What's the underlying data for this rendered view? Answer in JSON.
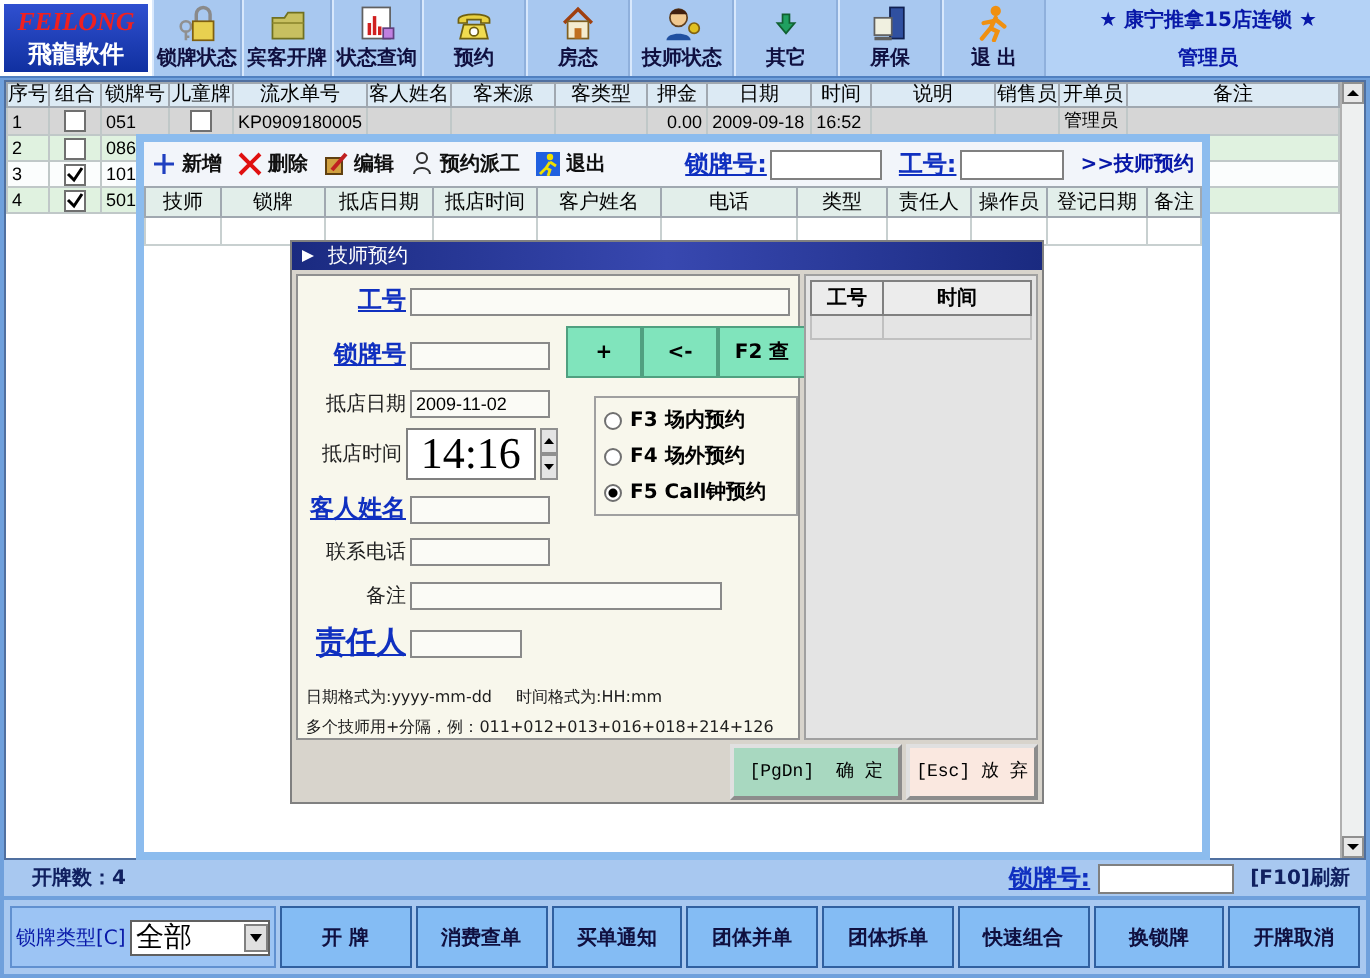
{
  "header": {
    "logo_top": "FEILONG",
    "logo_bottom": "飛龍軟件",
    "store": "★ 康宁推拿15店连锁 ★",
    "user": "管理员"
  },
  "toolbar": [
    {
      "label": "锁牌状态",
      "kind": "lock"
    },
    {
      "label": "宾客开牌",
      "kind": "folder"
    },
    {
      "label": "状态查询",
      "kind": "chart"
    },
    {
      "label": "预约",
      "kind": "phone"
    },
    {
      "label": "房态",
      "kind": "house"
    },
    {
      "label": "技师状态",
      "kind": "person"
    },
    {
      "label": "其它",
      "kind": "arrow"
    },
    {
      "label": "屏保",
      "kind": "computer"
    },
    {
      "label": "退 出",
      "kind": "runner"
    }
  ],
  "main_table": {
    "columns": [
      "序号",
      "组合",
      "锁牌号",
      "儿童牌",
      "流水单号",
      "客人姓名",
      "客来源",
      "客类型",
      "押金",
      "日期",
      "时间",
      "说明",
      "销售员",
      "开单员",
      "备注"
    ],
    "rows": [
      {
        "no": "1",
        "selected": true,
        "combined": false,
        "lock_no": "051",
        "child": false,
        "serial": "KP0909180005",
        "deposit": "0.00",
        "date": "2009-09-18",
        "time": "16:52",
        "opener": "管理员"
      },
      {
        "no": "2",
        "selected": false,
        "combined": false,
        "lock_no": "086"
      },
      {
        "no": "3",
        "selected": false,
        "combined": true,
        "lock_no": "101"
      },
      {
        "no": "4",
        "selected": false,
        "combined": true,
        "lock_no": "501"
      }
    ]
  },
  "status_bar": {
    "count": "开牌数：4",
    "lock_link": "锁牌号:",
    "refresh": "[F10]刷新"
  },
  "bottom_bar": {
    "type_label": "锁牌类型[C]",
    "type_value": "全部",
    "buttons": [
      "开 牌",
      "消费查单",
      "买单通知",
      "团体并单",
      "团体拆单",
      "快速组合",
      "换锁牌",
      "开牌取消"
    ]
  },
  "booking_list": {
    "actions": [
      {
        "label": "新增",
        "kind": "add"
      },
      {
        "label": "删除",
        "kind": "delete"
      },
      {
        "label": "编辑",
        "kind": "edit"
      },
      {
        "label": "预约派工",
        "kind": "dispatch"
      },
      {
        "label": "退出",
        "kind": "exit"
      }
    ],
    "lock_label": "锁牌号:",
    "staff_label": "工号:",
    "link": ">>技师预约",
    "columns": [
      "技师",
      "锁牌",
      "抵店日期",
      "抵店时间",
      "客户姓名",
      "电话",
      "类型",
      "责任人",
      "操作员",
      "登记日期",
      "备注"
    ]
  },
  "booking_dialog": {
    "title": "技师预约",
    "staff_no_label": "工号",
    "lock_no_label": "锁牌号",
    "keypad": [
      "+",
      "<-",
      "F2 查"
    ],
    "date_label": "抵店日期",
    "date_value": "2009-11-02",
    "time_label": "抵店时间",
    "time_value": "14:16",
    "modes": [
      {
        "label": "F3 场内预约",
        "selected": false
      },
      {
        "label": "F4 场外预约",
        "selected": false
      },
      {
        "label": "F5 Call钟预约",
        "selected": true
      }
    ],
    "guest_label": "客人姓名",
    "phone_label": "联系电话",
    "note_label": "备注",
    "owner_label": "责任人",
    "hints": [
      "日期格式为:yyyy-mm-dd",
      "时间格式为:HH:mm",
      "多个技师用+分隔，例：011+012+013+016+018+214+126"
    ],
    "side_columns": [
      "工号",
      "时间"
    ],
    "buttons": [
      {
        "label": "[PgDn]  确 定",
        "kind": "confirm"
      },
      {
        "label": "[Esc] 放 弃",
        "kind": "cancel"
      }
    ]
  }
}
